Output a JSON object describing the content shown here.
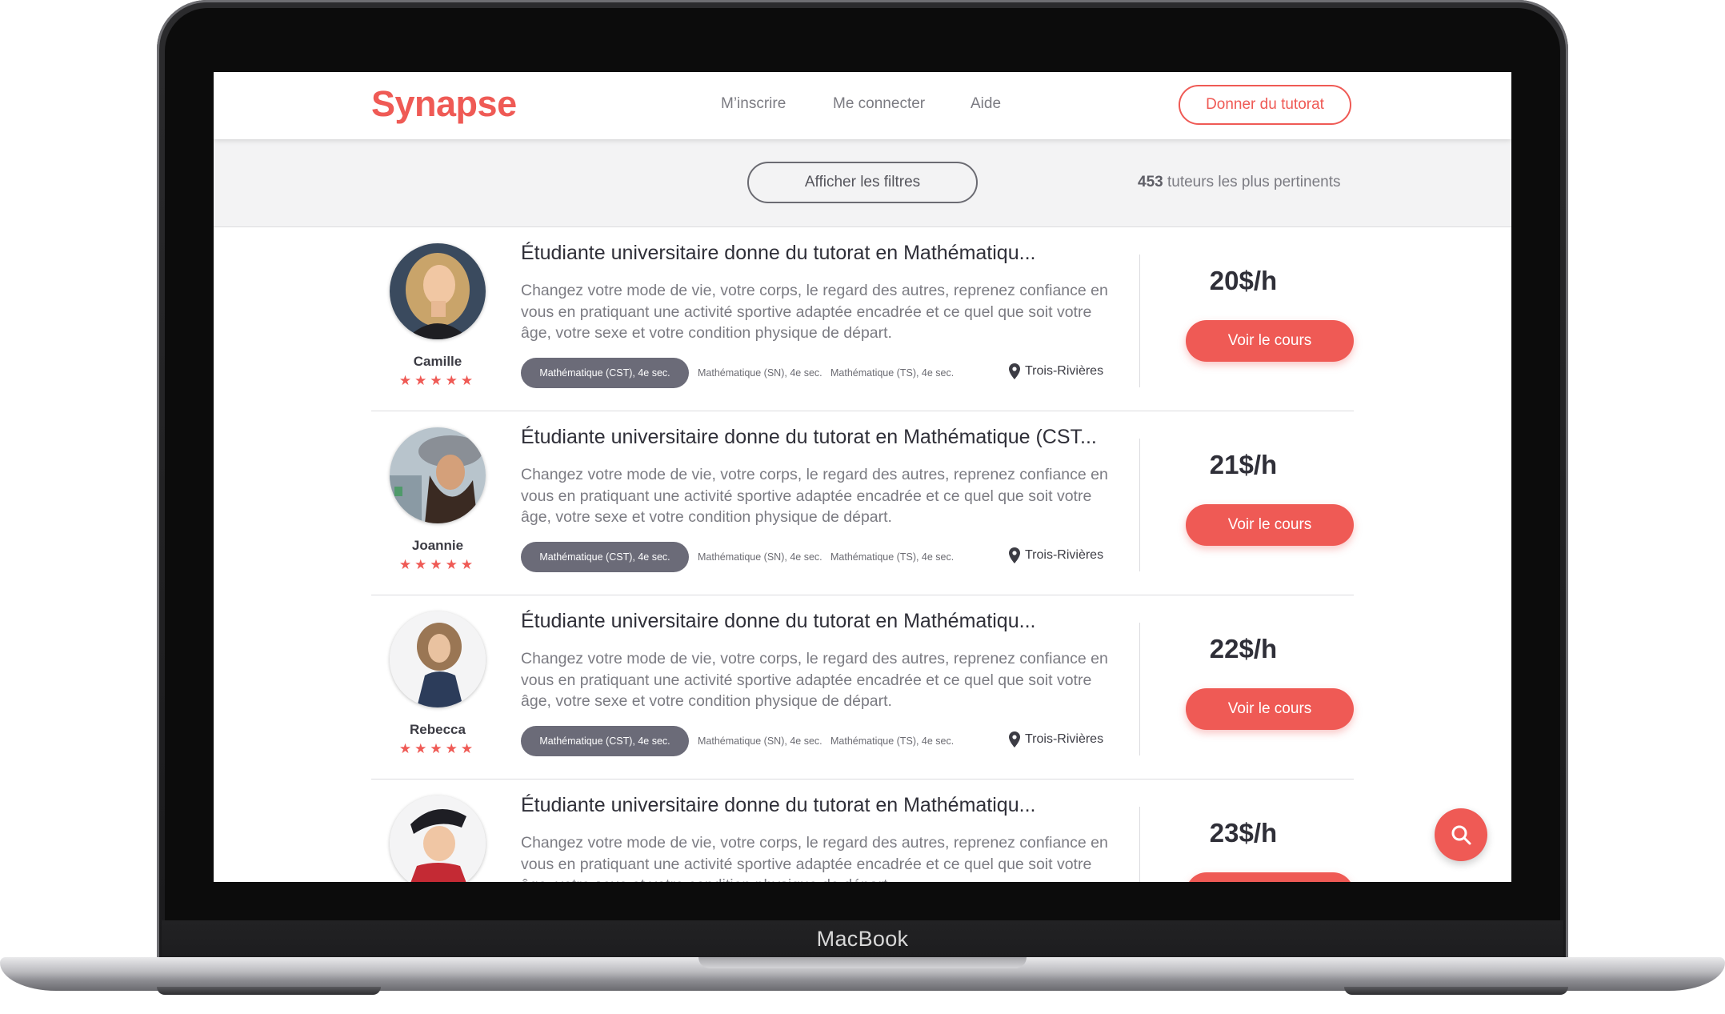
{
  "device": {
    "brand_label": "MacBook"
  },
  "header": {
    "logo": "Synapse",
    "nav": [
      "M’inscrire",
      "Me connecter",
      "Aide"
    ],
    "cta_label": "Donner du tutorat"
  },
  "filters": {
    "button_label": "Afficher les filtres",
    "results_count": "453",
    "results_text": "tuteurs les plus pertinents"
  },
  "listings": [
    {
      "name": "Camille",
      "rating": "★★★★★",
      "title": "Étudiante universitaire donne du tutorat en Mathématiqu...",
      "description": "Changez votre mode de vie, votre corps, le regard des autres, reprenez confiance en vous en pratiquant une activité sportive adaptée encadrée et ce quel que soit votre âge, votre sexe et votre condition physique de départ.",
      "tags": [
        "Mathématique (CST), 4e sec.",
        "Mathématique (SN), 4e sec.",
        "Mathématique (TS), 4e sec."
      ],
      "location": "Trois-Rivières",
      "price": "20$/h",
      "button": "Voir le cours"
    },
    {
      "name": "Joannie",
      "rating": "★★★★★",
      "title": "Étudiante universitaire donne du tutorat en Mathématique (CST...",
      "description": "Changez votre mode de vie, votre corps, le regard des autres, reprenez confiance en vous en pratiquant une activité sportive adaptée encadrée et ce quel que soit votre âge, votre sexe et votre condition physique de départ.",
      "tags": [
        "Mathématique (CST), 4e sec.",
        "Mathématique (SN), 4e sec.",
        "Mathématique (TS), 4e sec."
      ],
      "location": "Trois-Rivières",
      "price": "21$/h",
      "button": "Voir le cours"
    },
    {
      "name": "Rebecca",
      "rating": "★★★★★",
      "title": "Étudiante universitaire donne du tutorat en Mathématiqu...",
      "description": "Changez votre mode de vie, votre corps, le regard des autres, reprenez confiance en vous en pratiquant une activité sportive adaptée encadrée et ce quel que soit votre âge, votre sexe et votre condition physique de départ.",
      "tags": [
        "Mathématique (CST), 4e sec.",
        "Mathématique (SN), 4e sec.",
        "Mathématique (TS), 4e sec."
      ],
      "location": "Trois-Rivières",
      "price": "22$/h",
      "button": "Voir le cours"
    },
    {
      "title": "Étudiante universitaire donne du tutorat en Mathématiqu...",
      "description": "Changez votre mode de vie, votre corps, le regard des autres, reprenez confiance en vous en pratiquant une activité sportive adaptée encadrée et ce quel que soit votre âge, votre sexe et votre condition physique de départ.",
      "price": "23$/h"
    }
  ],
  "fab": {
    "icon": "search-icon"
  },
  "colors": {
    "accent": "#ef5a55",
    "tag_bg": "#6b6b78",
    "text": "#2f2f38",
    "muted": "#7b7b82"
  }
}
